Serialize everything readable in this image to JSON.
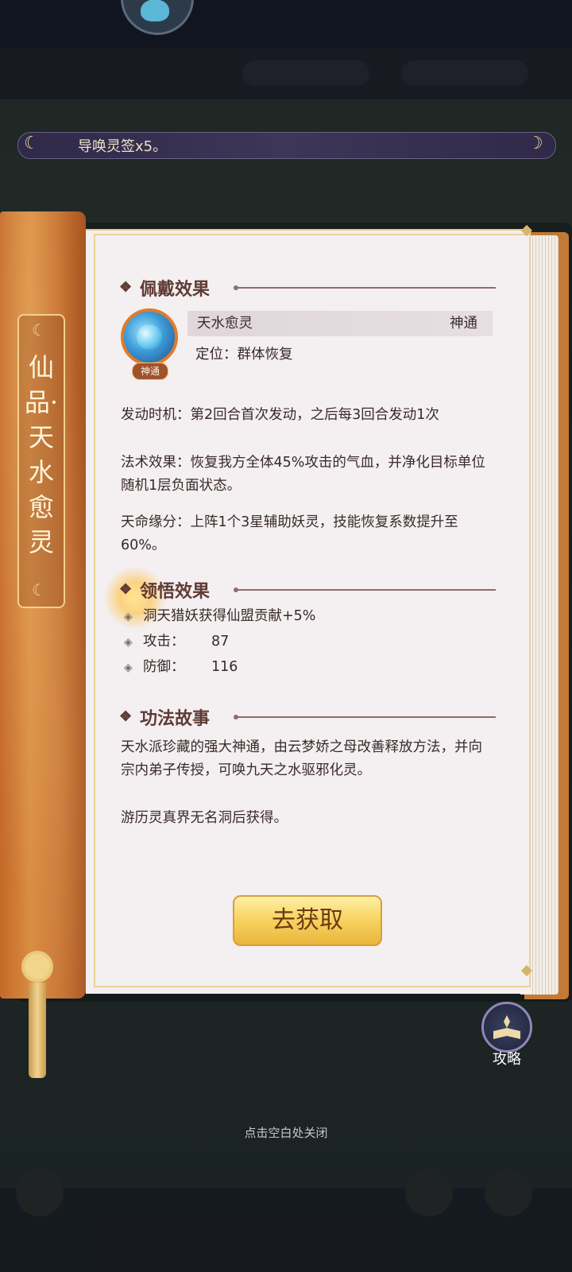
{
  "notice": {
    "text": "导唤灵签x5。"
  },
  "book": {
    "spine_title": "仙品·天水愈灵",
    "equip_section": {
      "title": "佩戴效果",
      "skill_name": "天水愈灵",
      "skill_type": "神通",
      "skill_tag": "神通",
      "position_label": "定位：群体恢复"
    },
    "descriptions": [
      "发动时机：第2回合首次发动，之后每3回合发动1次",
      "法术效果：恢复我方全体45%攻击的气血，并净化目标单位随机1层负面状态。",
      "天命缘分：上阵1个3星辅助妖灵，技能恢复系数提升至60%。"
    ],
    "comprehend_section": {
      "title": "领悟效果",
      "items": [
        {
          "label": "洞天猎妖获得仙盟贡献+5%",
          "value": ""
        },
        {
          "label": "攻击：",
          "value": "87"
        },
        {
          "label": "防御：",
          "value": "116"
        }
      ]
    },
    "story_section": {
      "title": "功法故事",
      "paragraphs": [
        "天水派珍藏的强大神通，由云梦娇之母改善释放方法，并向宗内弟子传授，可唤九天之水驱邪化灵。",
        "游历灵真界无名洞后获得。"
      ]
    },
    "get_button": "去获取"
  },
  "guide": {
    "label": "攻略"
  },
  "close_hint": "点击空白处关闭",
  "colors": {
    "accent": "#e17a2c",
    "button": "#f8d564",
    "spine": "#c4692a"
  }
}
